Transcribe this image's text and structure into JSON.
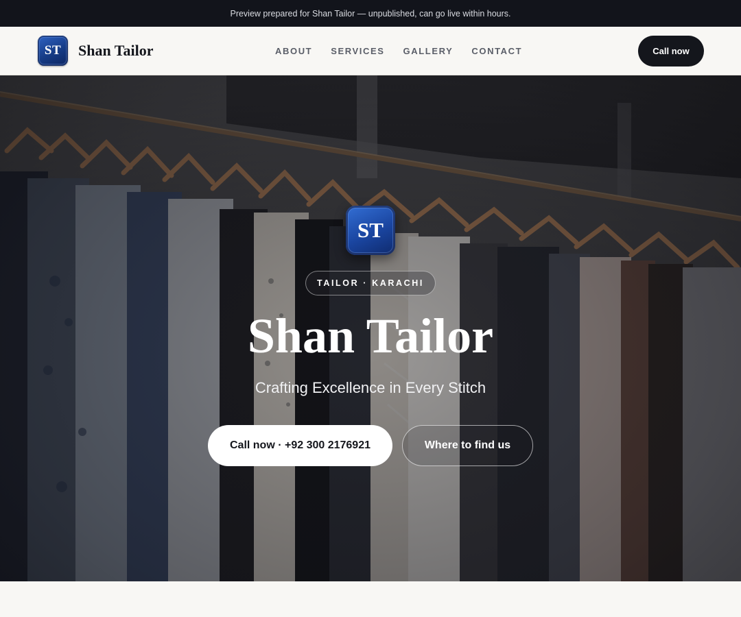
{
  "preview_banner": {
    "text": "Preview prepared for Shan Tailor — unpublished, can go live within hours."
  },
  "header": {
    "logo_initials": "ST",
    "brand_name": "Shan Tailor",
    "nav": [
      {
        "label": "ABOUT"
      },
      {
        "label": "SERVICES"
      },
      {
        "label": "GALLERY"
      },
      {
        "label": "CONTACT"
      }
    ],
    "cta_label": "Call now"
  },
  "hero": {
    "logo_initials": "ST",
    "tag": "TAILOR · KARACHI",
    "title": "Shan Tailor",
    "subtitle": "Crafting Excellence in Every Stitch",
    "primary_button": "Call now · +92 300 2176921",
    "secondary_button": "Where to find us",
    "background_image": "clothing rack with garments on wooden hangers"
  },
  "colors": {
    "banner_bg": "#12141b",
    "brand_blue": "#1a45a0",
    "dark_button": "#14161c",
    "page_bg": "#f8f7f4"
  },
  "icons": {
    "logo": "monogram-badge"
  }
}
